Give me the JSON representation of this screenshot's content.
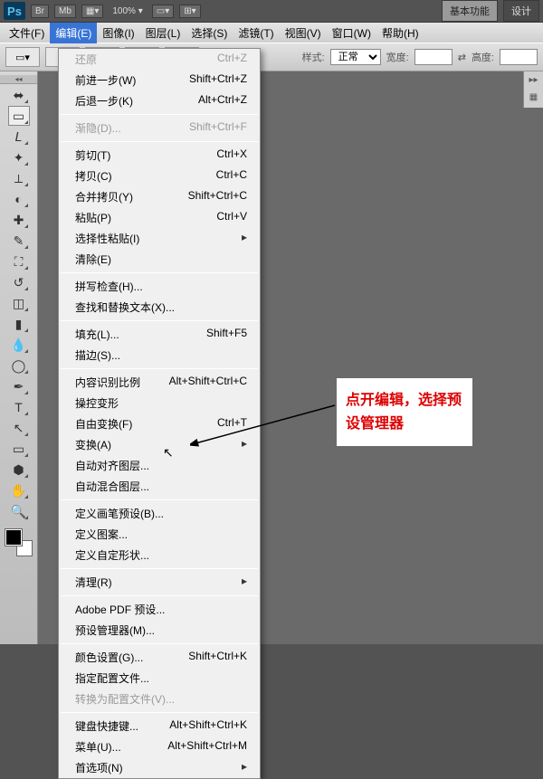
{
  "top": {
    "logo": "Ps",
    "br": "Br",
    "mb": "Mb",
    "zoom": "100%",
    "tab_basic": "基本功能",
    "tab_design": "设计"
  },
  "menubar": {
    "file": "文件(F)",
    "edit": "编辑(E)",
    "image": "图像(I)",
    "layer": "图层(L)",
    "select": "选择(S)",
    "filter": "滤镜(T)",
    "view": "视图(V)",
    "window": "窗口(W)",
    "help": "帮助(H)"
  },
  "optbar": {
    "style_label": "样式:",
    "style_value": "正常",
    "width_label": "宽度:",
    "height_label": "高度:"
  },
  "dropdown": [
    {
      "label": "还原",
      "shortcut": "Ctrl+Z",
      "disabled": true
    },
    {
      "label": "前进一步(W)",
      "shortcut": "Shift+Ctrl+Z",
      "disabled": false
    },
    {
      "label": "后退一步(K)",
      "shortcut": "Alt+Ctrl+Z",
      "disabled": false
    },
    {
      "sep": true
    },
    {
      "label": "渐隐(D)...",
      "shortcut": "Shift+Ctrl+F",
      "disabled": true
    },
    {
      "sep": true
    },
    {
      "label": "剪切(T)",
      "shortcut": "Ctrl+X",
      "disabled": false
    },
    {
      "label": "拷贝(C)",
      "shortcut": "Ctrl+C",
      "disabled": false
    },
    {
      "label": "合并拷贝(Y)",
      "shortcut": "Shift+Ctrl+C",
      "disabled": false
    },
    {
      "label": "粘贴(P)",
      "shortcut": "Ctrl+V",
      "disabled": false
    },
    {
      "label": "选择性粘贴(I)",
      "shortcut": "",
      "disabled": false,
      "sub": true
    },
    {
      "label": "清除(E)",
      "shortcut": "",
      "disabled": false
    },
    {
      "sep": true
    },
    {
      "label": "拼写检查(H)...",
      "shortcut": "",
      "disabled": false
    },
    {
      "label": "查找和替换文本(X)...",
      "shortcut": "",
      "disabled": false
    },
    {
      "sep": true
    },
    {
      "label": "填充(L)...",
      "shortcut": "Shift+F5",
      "disabled": false
    },
    {
      "label": "描边(S)...",
      "shortcut": "",
      "disabled": false
    },
    {
      "sep": true
    },
    {
      "label": "内容识别比例",
      "shortcut": "Alt+Shift+Ctrl+C",
      "disabled": false
    },
    {
      "label": "操控变形",
      "shortcut": "",
      "disabled": false
    },
    {
      "label": "自由变换(F)",
      "shortcut": "Ctrl+T",
      "disabled": false
    },
    {
      "label": "变换(A)",
      "shortcut": "",
      "disabled": false,
      "sub": true
    },
    {
      "label": "自动对齐图层...",
      "shortcut": "",
      "disabled": false
    },
    {
      "label": "自动混合图层...",
      "shortcut": "",
      "disabled": false
    },
    {
      "sep": true
    },
    {
      "label": "定义画笔预设(B)...",
      "shortcut": "",
      "disabled": false
    },
    {
      "label": "定义图案...",
      "shortcut": "",
      "disabled": false
    },
    {
      "label": "定义自定形状...",
      "shortcut": "",
      "disabled": false
    },
    {
      "sep": true
    },
    {
      "label": "清理(R)",
      "shortcut": "",
      "disabled": false,
      "sub": true
    },
    {
      "sep": true
    },
    {
      "label": "Adobe PDF 预设...",
      "shortcut": "",
      "disabled": false
    },
    {
      "label": "预设管理器(M)...",
      "shortcut": "",
      "disabled": false
    },
    {
      "sep": true
    },
    {
      "label": "颜色设置(G)...",
      "shortcut": "Shift+Ctrl+K",
      "disabled": false
    },
    {
      "label": "指定配置文件...",
      "shortcut": "",
      "disabled": false
    },
    {
      "label": "转换为配置文件(V)...",
      "shortcut": "",
      "disabled": true
    },
    {
      "sep": true
    },
    {
      "label": "键盘快捷键...",
      "shortcut": "Alt+Shift+Ctrl+K",
      "disabled": false
    },
    {
      "label": "菜单(U)...",
      "shortcut": "Alt+Shift+Ctrl+M",
      "disabled": false
    },
    {
      "label": "首选项(N)",
      "shortcut": "",
      "disabled": false,
      "sub": true
    }
  ],
  "annotation": "点开编辑，选择预设管理器",
  "tools": [
    {
      "name": "move-tool",
      "glyph": "⬌"
    },
    {
      "name": "marquee-tool",
      "glyph": "▭",
      "sel": true
    },
    {
      "name": "lasso-tool",
      "glyph": "𝘓"
    },
    {
      "name": "wand-tool",
      "glyph": "✦"
    },
    {
      "name": "crop-tool",
      "glyph": "⟂"
    },
    {
      "name": "eyedropper-tool",
      "glyph": "◐"
    },
    {
      "name": "heal-tool",
      "glyph": "✚"
    },
    {
      "name": "brush-tool",
      "glyph": "✎"
    },
    {
      "name": "stamp-tool",
      "glyph": "⛶"
    },
    {
      "name": "history-brush",
      "glyph": "↺"
    },
    {
      "name": "eraser-tool",
      "glyph": "◫"
    },
    {
      "name": "gradient-tool",
      "glyph": "▮"
    },
    {
      "name": "blur-tool",
      "glyph": "💧"
    },
    {
      "name": "dodge-tool",
      "glyph": "◯"
    },
    {
      "name": "pen-tool",
      "glyph": "✒"
    },
    {
      "name": "type-tool",
      "glyph": "T"
    },
    {
      "name": "path-tool",
      "glyph": "↖"
    },
    {
      "name": "shape-tool",
      "glyph": "▭"
    },
    {
      "name": "3d-tool",
      "glyph": "⬢"
    },
    {
      "name": "hand-tool",
      "glyph": "✋"
    },
    {
      "name": "zoom-tool",
      "glyph": "🔍"
    }
  ]
}
